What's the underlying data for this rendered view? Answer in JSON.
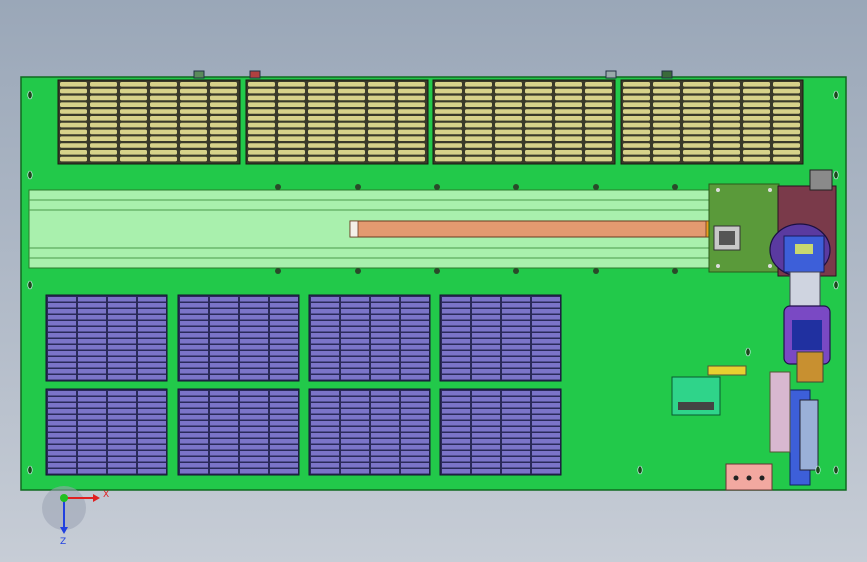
{
  "colors": {
    "background_top": "#9aa7b8",
    "board": "#22c94a",
    "board_edge": "#0f6a1f",
    "tray_slats": "#d7d28a",
    "tray_gaps": "#3a3a2a",
    "rail": "#a9f0ad",
    "slider": "#e39a70",
    "cell_grid": "#7b74c8",
    "robot_purple": "#7a49c4",
    "robot_blue": "#3d5fd9",
    "axis_x": "#e02020",
    "axis_y": "#2040e0",
    "axis_origin": "#20c020"
  },
  "axes": {
    "x_label": "X",
    "y_label": "Z"
  },
  "icons": [
    "mounting-hole-icon",
    "coordinate-axis-icon"
  ]
}
